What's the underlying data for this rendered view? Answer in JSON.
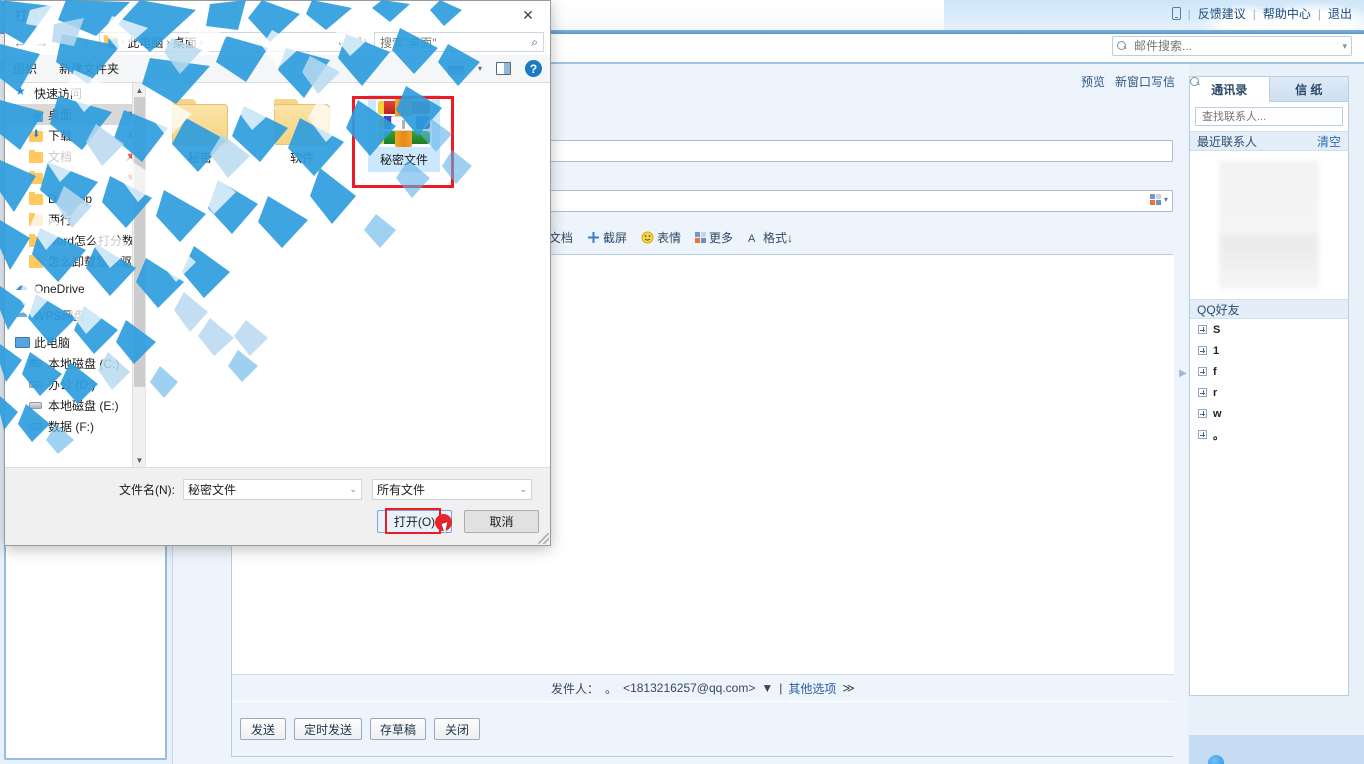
{
  "mail": {
    "header": {
      "phone_icon": "phone-icon",
      "links": [
        "反馈建议",
        "帮助中心",
        "退出"
      ],
      "search_placeholder": "邮件搜索...",
      "search_value": ""
    },
    "compose": {
      "top_links": [
        "预览",
        "新窗口写信"
      ],
      "recipient_value": "",
      "subject_value": "",
      "toolbar": [
        {
          "label": "文档",
          "icon": "document-icon"
        },
        {
          "label": "截屏",
          "icon": "screenshot-icon"
        },
        {
          "label": "表情",
          "icon": "emoji-icon"
        },
        {
          "label": "更多",
          "icon": "more-grid-icon"
        },
        {
          "label": "格式↓",
          "icon": "format-icon"
        }
      ],
      "sender_label": "发件人：",
      "sender_name": "。",
      "sender_address": "<1813216257@qq.com>",
      "sender_caret": "▼",
      "divider": "|",
      "other_options": "其他选项",
      "other_options_caret": "≫",
      "buttons": [
        "发送",
        "定时发送",
        "存草稿",
        "关闭"
      ]
    },
    "contacts": {
      "tabs": [
        {
          "label": "通讯录",
          "active": true
        },
        {
          "label": "信 纸",
          "active": false
        }
      ],
      "search_placeholder": "查找联系人...",
      "recent_title": "最近联系人",
      "recent_clear": "清空",
      "group_title": "QQ好友",
      "friends": [
        "S",
        "1",
        "f",
        "r",
        "w",
        "。"
      ]
    }
  },
  "dialog": {
    "title": "打开",
    "close_icon": "close-icon",
    "nav": {
      "back": "←",
      "forward": "→",
      "recent": "⌄",
      "up": "↑"
    },
    "breadcrumb": [
      "此电脑",
      "桌面"
    ],
    "breadcrumb_sep": "›",
    "refresh_icon": "refresh-icon",
    "search_placeholder": "搜索\"桌面\"",
    "toolbar": {
      "organize": "组织",
      "new_folder": "新建文件夹",
      "view_icon": "view-layout-icon",
      "pane_icon": "preview-pane-icon",
      "help_icon": "help-icon",
      "help_label": "?"
    },
    "sidebar": [
      {
        "label": "快速访问",
        "icon": "star-icon",
        "indent": false,
        "selected": false,
        "pinned": false
      },
      {
        "label": "桌面",
        "icon": "folder-blue-icon",
        "indent": true,
        "selected": true,
        "pinned": true
      },
      {
        "label": "下载",
        "icon": "download-folder-icon",
        "indent": true,
        "selected": false,
        "pinned": true
      },
      {
        "label": "文档",
        "icon": "documents-folder-icon",
        "indent": true,
        "selected": false,
        "pinned": true
      },
      {
        "label": "",
        "icon": "folder-icon",
        "indent": true,
        "selected": false,
        "pinned": true
      },
      {
        "label": "Desktop",
        "icon": "folder-icon",
        "indent": true,
        "selected": false,
        "pinned": false
      },
      {
        "label": "两行",
        "icon": "folder-icon",
        "indent": true,
        "selected": false,
        "pinned": false
      },
      {
        "label": "word怎么打分数",
        "icon": "folder-icon",
        "indent": true,
        "selected": false,
        "pinned": false
      },
      {
        "label": "怎么卸载显卡驱动",
        "icon": "folder-icon",
        "indent": true,
        "selected": false,
        "pinned": false
      },
      {
        "label": "OneDrive",
        "icon": "onedrive-icon",
        "indent": false,
        "selected": false,
        "pinned": false
      },
      {
        "label": "WPS网盘",
        "icon": "wps-cloud-icon",
        "indent": false,
        "selected": false,
        "pinned": false
      },
      {
        "label": "此电脑",
        "icon": "this-pc-icon",
        "indent": false,
        "selected": false,
        "pinned": false
      },
      {
        "label": "本地磁盘 (C:)",
        "icon": "system-drive-icon",
        "indent": true,
        "selected": false,
        "pinned": false
      },
      {
        "label": "办公 (D:)",
        "icon": "drive-icon",
        "indent": true,
        "selected": false,
        "pinned": false
      },
      {
        "label": "本地磁盘 (E:)",
        "icon": "drive-icon",
        "indent": true,
        "selected": false,
        "pinned": false
      },
      {
        "label": "数据 (F:)",
        "icon": "drive-icon",
        "indent": true,
        "selected": false,
        "pinned": false
      }
    ],
    "files": [
      {
        "name": "秘密",
        "type": "folder",
        "selected": false
      },
      {
        "name": "软件",
        "type": "folder",
        "selected": false
      },
      {
        "name": "秘密文件",
        "type": "rar-archive",
        "selected": true
      }
    ],
    "footer": {
      "filename_label": "文件名(N):",
      "filename_value": "秘密文件",
      "filter_value": "所有文件",
      "open_button": "打开(O)",
      "cancel_button": "取消"
    }
  },
  "colors": {
    "accent_blue": "#1a7bc4",
    "selection_red": "#ed1c24",
    "cursor_red": "#e8252b",
    "mail_panel": "#eef4fb",
    "win_chrome": "#f0f0f0"
  }
}
